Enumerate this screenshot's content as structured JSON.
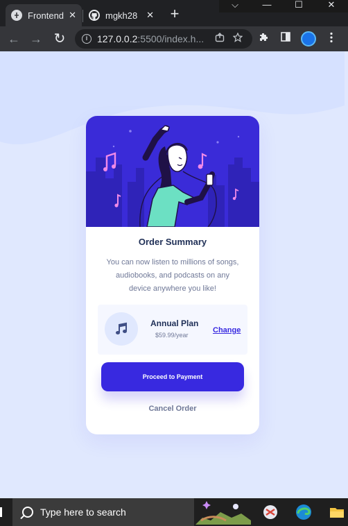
{
  "browser": {
    "tabs": [
      {
        "title": "Frontend",
        "close": "✕",
        "icon": "frontend-mentor-favicon"
      },
      {
        "title": "mgkh28",
        "close": "✕",
        "icon": "github-favicon"
      }
    ],
    "new_tab": "+",
    "window_controls": {
      "chevron": "⌵",
      "minimize": "—",
      "maximize": "☐",
      "close": "✕"
    },
    "nav": {
      "back": "←",
      "forward": "→",
      "reload": "↻"
    },
    "url_host": "127.0.0.2",
    "url_rest": ":5500/index.h...",
    "icons": [
      "info-icon",
      "share-icon",
      "star-icon",
      "extensions-icon",
      "side-panel-icon",
      "profile-avatar",
      "menu-icon"
    ]
  },
  "card": {
    "title": "Order Summary",
    "description": "You can now listen to millions of songs, audiobooks, and podcasts on any device anywhere you like!",
    "plan": {
      "name": "Annual Plan",
      "price": "$59.99/year",
      "change_label": "Change"
    },
    "pay_label": "Proceed to Payment",
    "cancel_label": "Cancel Order"
  },
  "colors": {
    "page_bg": "#e0e8fe",
    "accent": "#3829e0",
    "heading": "#1f2f56",
    "muted": "#6f7897",
    "plan_bg": "#f5f7ff"
  },
  "taskbar": {
    "search_placeholder": "Type here to search",
    "apps": [
      "snipping-tool-icon",
      "edge-icon",
      "file-explorer-icon"
    ]
  }
}
